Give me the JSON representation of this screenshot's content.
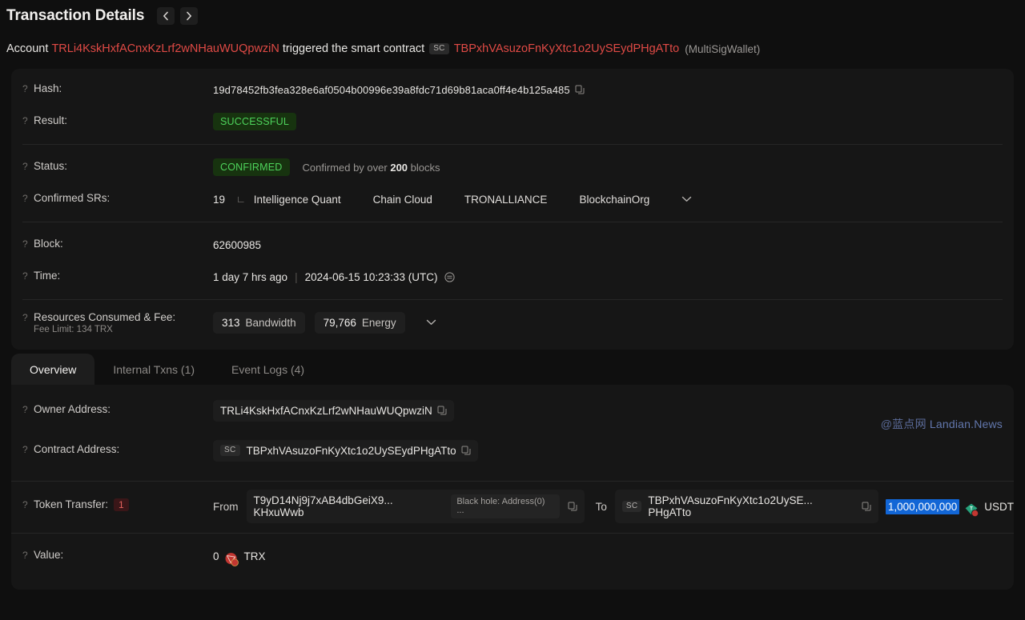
{
  "header": {
    "title": "Transaction Details",
    "prev_icon": "chevron-left-icon",
    "next_icon": "chevron-right-icon"
  },
  "subtitle": {
    "prefix": "Account",
    "account_address": "TRLi4KskHxfACnxKzLrf2wNHauWUQpwziN",
    "middle": "triggered the smart contract",
    "sc_tag": "SC",
    "contract_address": "TBPxhVAsuzoFnKyXtc1o2UySEydPHgATto",
    "contract_name": "(MultiSigWallet)"
  },
  "summary": {
    "hash": {
      "label": "Hash:",
      "value": "19d78452fb3fea328e6af0504b00996e39a8fdc71d69b81aca0ff4e4b125a485"
    },
    "result": {
      "label": "Result:",
      "badge": "SUCCESSFUL"
    },
    "status": {
      "label": "Status:",
      "badge": "CONFIRMED",
      "note_prefix": "Confirmed by over",
      "note_count": "200",
      "note_suffix": "blocks"
    },
    "confirmed_srs": {
      "label": "Confirmed SRs:",
      "count": "19",
      "names": [
        "Intelligence Quant",
        "Chain Cloud",
        "TRONALLIANCE",
        "BlockchainOrg"
      ]
    },
    "block": {
      "label": "Block:",
      "value": "62600985"
    },
    "time": {
      "label": "Time:",
      "relative": "1 day 7 hrs ago",
      "absolute": "2024-06-15 10:23:33 (UTC)"
    },
    "resources": {
      "label": "Resources Consumed & Fee:",
      "fee_limit": "Fee Limit: 134 TRX",
      "bandwidth_value": "313",
      "bandwidth_unit": "Bandwidth",
      "energy_value": "79,766",
      "energy_unit": "Energy"
    }
  },
  "tabs": [
    {
      "label": "Overview",
      "active": true
    },
    {
      "label": "Internal Txns (1)",
      "active": false
    },
    {
      "label": "Event Logs (4)",
      "active": false
    }
  ],
  "overview": {
    "owner_address": {
      "label": "Owner Address:",
      "value": "TRLi4KskHxfACnxKzLrf2wNHauWUQpwziN"
    },
    "contract_address": {
      "label": "Contract Address:",
      "sc_tag": "SC",
      "value": "TBPxhVAsuzoFnKyXtc1o2UySEydPHgATto"
    },
    "token_transfer": {
      "label": "Token Transfer:",
      "count": "1",
      "from_label": "From",
      "from_address": "T9yD14Nj9j7xAB4dbGeiX9... KHxuWwb",
      "from_tag": "Black hole: Address(0) ...",
      "to_label": "To",
      "to_sc_tag": "SC",
      "to_address": "TBPxhVAsuzoFnKyXtc1o2UySE... PHgATto",
      "amount": "1,000,000,000",
      "token_symbol": "USDT"
    },
    "value": {
      "label": "Value:",
      "amount": "0",
      "symbol": "TRX"
    }
  },
  "watermark": {
    "cn": "@蓝点网",
    "en": "Landian.News"
  }
}
